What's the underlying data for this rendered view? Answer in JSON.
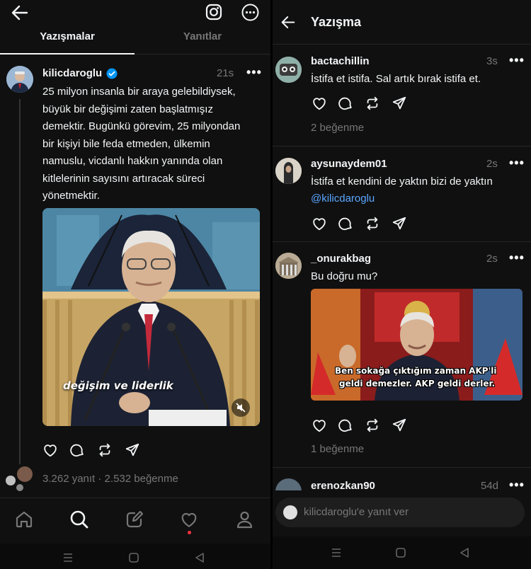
{
  "left": {
    "tabs": [
      {
        "label": "Yazışmalar",
        "active": true
      },
      {
        "label": "Yanıtlar",
        "active": false
      }
    ],
    "post": {
      "username": "kilicdaroglu",
      "verified": true,
      "time": "21s",
      "more": "•••",
      "text": [
        "25 milyon insanla bir araya gelebildiysek,",
        "büyük bir değişimi zaten başlatmışız",
        "demektir. Bugünkü görevim, 25 milyondan",
        "bir kişiyi bile feda etmeden, ülkemin",
        "namuslu, vicdanlı hakkın yanında olan",
        "kitlelerinin sayısını artıracak süreci",
        "yönetmektir."
      ],
      "video_caption": "değişim ve liderlik",
      "stats": "3.262 yanıt · 2.532 beğenme"
    },
    "nav": [
      "home-icon",
      "search-icon",
      "compose-icon",
      "heart-icon",
      "profile-icon"
    ]
  },
  "right": {
    "header_title": "Yazışma",
    "replies": [
      {
        "username": "bactachillin",
        "time": "3s",
        "text": "İstifa et istifa. Sal artık bırak istifa et.",
        "likes": "2 beğenme"
      },
      {
        "username": "aysunaydem01",
        "time": "2s",
        "text": "İstifa et kendini de yaktın bizi de yaktın",
        "mention": "@kilicdaroglu"
      },
      {
        "username": "_onurakbag",
        "time": "2s",
        "text": "Bu doğru mu?",
        "image_subtitle_1": "Ben sokağa çıktığım zaman AKP'li",
        "image_subtitle_2": "geldi demezler. AKP geldi derler.",
        "likes": "1 beğenme"
      },
      {
        "username": "erenozkan90",
        "time": "54d"
      }
    ],
    "reply_placeholder": "kilicdaroglu'e yanıt ver"
  },
  "colors": {
    "background": "#101010",
    "text": "#f3f5f7",
    "muted": "#777777",
    "verified": "#0095f6",
    "mention": "#5aa7ff",
    "notification_dot": "#ff3040"
  }
}
